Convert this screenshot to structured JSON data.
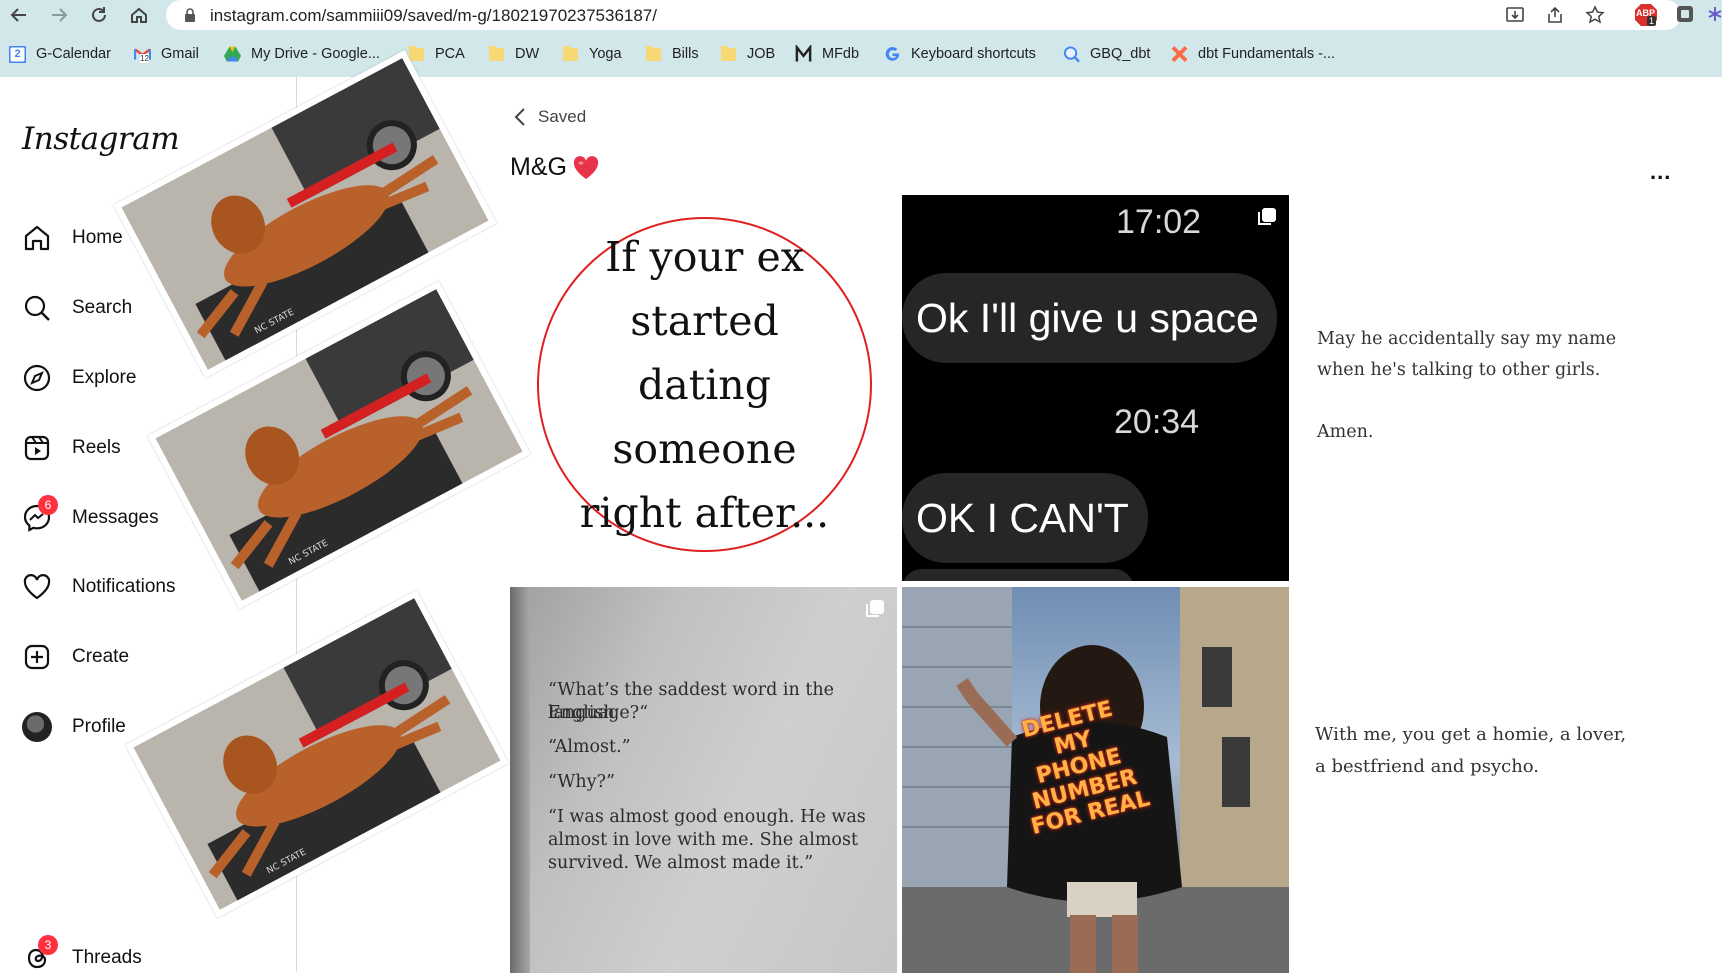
{
  "browser": {
    "url": "instagram.com/sammiii09/saved/m-g/18021970237536187/",
    "extension_badge": "ABP",
    "extension_count": "1",
    "bookmarks": [
      {
        "label": "G-Calendar",
        "icon": "calendar-icon"
      },
      {
        "label": "Gmail",
        "icon": "gmail-icon"
      },
      {
        "label": "My Drive - Google...",
        "icon": "drive-icon"
      },
      {
        "label": "PCA",
        "icon": "folder-icon"
      },
      {
        "label": "DW",
        "icon": "folder-icon"
      },
      {
        "label": "Yoga",
        "icon": "folder-icon"
      },
      {
        "label": "Bills",
        "icon": "folder-icon"
      },
      {
        "label": "JOB",
        "icon": "folder-icon"
      },
      {
        "label": "MFdb",
        "icon": "m-icon"
      },
      {
        "label": "Keyboard shortcuts",
        "icon": "google-icon"
      },
      {
        "label": "GBQ_dbt",
        "icon": "bigquery-icon"
      },
      {
        "label": "dbt Fundamentals -...",
        "icon": "dbt-icon"
      }
    ],
    "calendar_day": "2",
    "gmail_count": "12"
  },
  "sidebar": {
    "logo": "Instagram",
    "items": [
      {
        "label": "Home",
        "icon": "home-icon"
      },
      {
        "label": "Search",
        "icon": "search-icon"
      },
      {
        "label": "Explore",
        "icon": "compass-icon"
      },
      {
        "label": "Reels",
        "icon": "reels-icon"
      },
      {
        "label": "Messages",
        "icon": "messenger-icon",
        "badge": "6"
      },
      {
        "label": "Notifications",
        "icon": "heart-icon"
      },
      {
        "label": "Create",
        "icon": "plus-square-icon"
      },
      {
        "label": "Profile",
        "icon": "avatar"
      },
      {
        "label": "Threads",
        "icon": "threads-icon",
        "badge": "3"
      }
    ]
  },
  "main": {
    "back_label": "Saved",
    "collection_title": "M&G",
    "more_label": "...",
    "posts": {
      "circle_text": "If your ex started dating someone right after...",
      "chat": {
        "time1": "17:02",
        "message1": "Ok I'll give u space",
        "time2": "20:34",
        "message2": "OK I CAN'T"
      },
      "quote1": {
        "line1": "May he accidentally say my name",
        "line2": "when he's talking to other girls.",
        "line3": "Amen."
      },
      "book": {
        "p1_line1": "“What’s the saddest word in the English",
        "p1_line2": "language?“",
        "p2": "“Almost.”",
        "p3": "“Why?”",
        "p4_line1": "“I was almost good enough. He was",
        "p4_line2": "almost in love with me. She almost",
        "p4_line3": "survived. We almost made it.”"
      },
      "shirt": {
        "line1": "DELETE",
        "line2": "MY PHONE",
        "line3": "NUMBER",
        "line4": "FOR REAL"
      },
      "quote2": {
        "line1": "With me, you get a homie, a lover,",
        "line2": "a bestfriend and psycho."
      }
    }
  },
  "stickers": {
    "mat_text": "NC STATE"
  },
  "colors": {
    "chrome_bg": "#d2e7ea",
    "badge_red": "#ff3040",
    "circle_red": "#e02020"
  }
}
